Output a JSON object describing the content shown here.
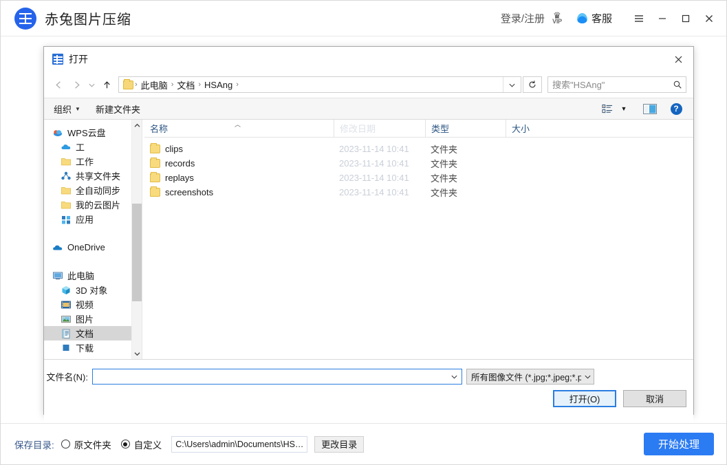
{
  "app": {
    "title": "赤兔图片压缩",
    "logo_icon": "grid-logo-icon",
    "accent_color": "#2b7bf3",
    "header": {
      "login_label": "登录/注册",
      "vip_label": "VIP",
      "vip_icon": "crown-icon",
      "service_label": "客服",
      "service_icon": "headset-icon",
      "menu_icon": "hamburger-menu-icon",
      "minimize_icon": "minimize-icon",
      "maximize_icon": "maximize-icon",
      "close_icon": "close-icon"
    }
  },
  "dialog": {
    "title": "打开",
    "icon": "explorer-window-icon",
    "close_icon": "close-icon",
    "nav": {
      "back_icon": "arrow-left-icon",
      "forward_icon": "arrow-right-icon",
      "history_icon": "chevron-down-icon",
      "up_icon": "arrow-up-icon",
      "folder_icon": "folder-icon",
      "dropdown_icon": "chevron-down-icon",
      "refresh_icon": "refresh-icon",
      "breadcrumbs": [
        "此电脑",
        "文档",
        "HSAng"
      ],
      "separator": "›"
    },
    "search": {
      "placeholder": "搜索\"HSAng\"",
      "value": "",
      "icon": "search-icon"
    },
    "toolbar": {
      "organize_label": "组织",
      "organize_caret": "▼",
      "new_folder_label": "新建文件夹",
      "view_icon": "list-view-icon",
      "view_caret": "▼",
      "preview_pane_icon": "preview-pane-icon",
      "help_icon": "help-icon",
      "help_glyph": "?"
    },
    "sidebar": {
      "scroll_up_icon": "chevron-up-icon",
      "scroll_down_icon": "chevron-down-icon",
      "items": [
        {
          "label": "WPS云盘",
          "icon": "wps-cloud-icon",
          "indent": 0,
          "selected": false
        },
        {
          "label": "工",
          "icon": "cloud-icon",
          "indent": 1,
          "selected": false
        },
        {
          "label": "工作",
          "icon": "folder-icon",
          "indent": 1,
          "selected": false
        },
        {
          "label": "共享文件夹",
          "icon": "share-icon",
          "indent": 1,
          "selected": false
        },
        {
          "label": "全自动同步",
          "icon": "folder-icon",
          "indent": 1,
          "selected": false
        },
        {
          "label": "我的云图片",
          "icon": "folder-icon",
          "indent": 1,
          "selected": false
        },
        {
          "label": "应用",
          "icon": "apps-icon",
          "indent": 1,
          "selected": false
        },
        {
          "label": "",
          "icon": "spacer",
          "indent": 0,
          "selected": false
        },
        {
          "label": "OneDrive",
          "icon": "onedrive-icon",
          "indent": 0,
          "selected": false
        },
        {
          "label": "",
          "icon": "spacer",
          "indent": 0,
          "selected": false
        },
        {
          "label": "此电脑",
          "icon": "this-pc-icon",
          "indent": 0,
          "selected": false
        },
        {
          "label": "3D 对象",
          "icon": "3d-objects-icon",
          "indent": 1,
          "selected": false
        },
        {
          "label": "视频",
          "icon": "videos-icon",
          "indent": 1,
          "selected": false
        },
        {
          "label": "图片",
          "icon": "pictures-icon",
          "indent": 1,
          "selected": false
        },
        {
          "label": "文档",
          "icon": "documents-icon",
          "indent": 1,
          "selected": true
        },
        {
          "label": "下载",
          "icon": "downloads-icon",
          "indent": 1,
          "selected": false
        }
      ]
    },
    "filelist": {
      "columns": [
        {
          "label": "名称",
          "key": "name"
        },
        {
          "label": "修改日期",
          "key": "date"
        },
        {
          "label": "类型",
          "key": "type"
        },
        {
          "label": "大小",
          "key": "size"
        }
      ],
      "sort_indicator": "︿",
      "rows": [
        {
          "name": "clips",
          "date": "2023-11-14 10:41",
          "type": "文件夹",
          "size": "",
          "icon": "folder-icon"
        },
        {
          "name": "records",
          "date": "2023-11-14 10:41",
          "type": "文件夹",
          "size": "",
          "icon": "folder-icon"
        },
        {
          "name": "replays",
          "date": "2023-11-14 10:41",
          "type": "文件夹",
          "size": "",
          "icon": "folder-icon"
        },
        {
          "name": "screenshots",
          "date": "2023-11-14 10:41",
          "type": "文件夹",
          "size": "",
          "icon": "folder-icon"
        }
      ]
    },
    "footer": {
      "filename_label": "文件名(N):",
      "filename_value": "",
      "filename_dropdown_icon": "chevron-down-icon",
      "filter_value": "所有图像文件 (*.jpg;*.jpeg;*.p",
      "filter_caret_icon": "chevron-down-icon",
      "open_label": "打开(O)",
      "cancel_label": "取消",
      "resize_grip_icon": "resize-grip-icon"
    }
  },
  "bottombar": {
    "save_dir_label": "保存目录:",
    "option_original": "原文件夹",
    "option_custom": "自定义",
    "selected_option": "自定义",
    "path_value": "C:\\Users\\admin\\Documents\\HS…",
    "change_dir_label": "更改目录",
    "start_label": "开始处理"
  }
}
